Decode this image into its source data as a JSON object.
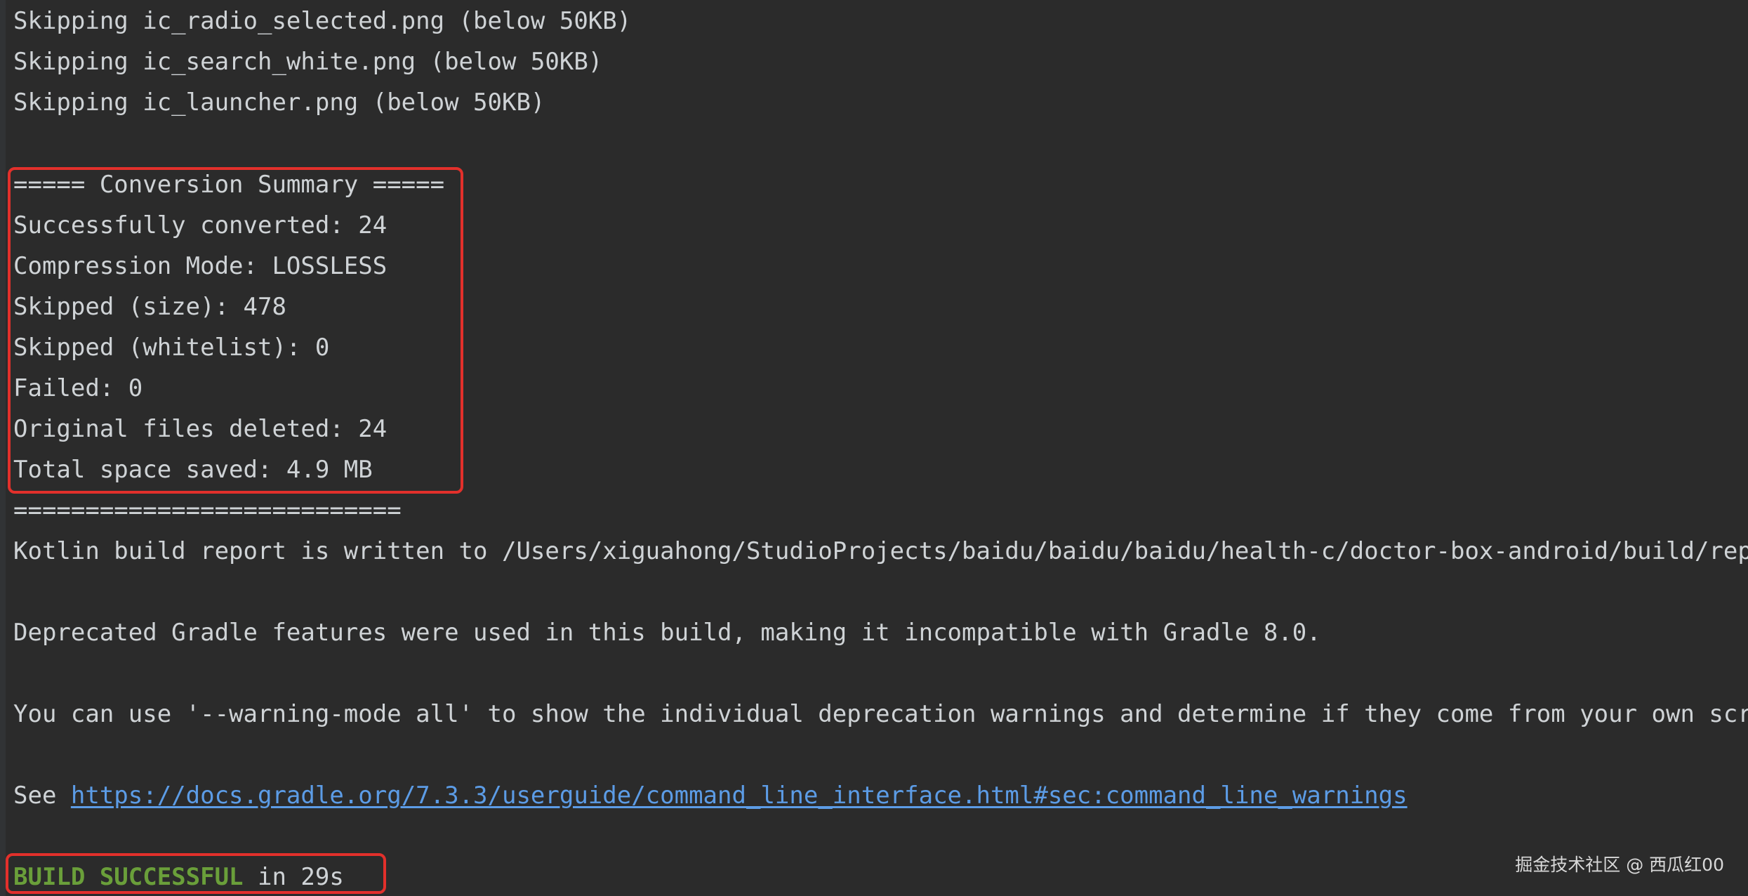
{
  "console": {
    "lines": [
      "Skipping ic_radio_selected.png (below 50KB)",
      "Skipping ic_search_white.png (below 50KB)",
      "Skipping ic_launcher.png (below 50KB)",
      "===== Conversion Summary =====",
      "Successfully converted: 24",
      "Compression Mode: LOSSLESS",
      "Skipped (size): 478",
      "Skipped (whitelist): 0",
      "Failed: 0",
      "Original files deleted: 24",
      "Total space saved: 4.9 MB",
      "===========================",
      "Kotlin build report is written to /Users/xiguahong/StudioProjects/baidu/baidu/baidu/health-c/doctor-box-android/build/reports",
      "Deprecated Gradle features were used in this build, making it incompatible with Gradle 8.0.",
      "You can use '--warning-mode all' to show the individual deprecation warnings and determine if they come from your own scripts",
      "See ",
      "https://docs.gradle.org/7.3.3/userguide/command_line_interface.html#sec:command_line_warnings",
      "BUILD SUCCESSFUL",
      " in 29s"
    ]
  },
  "watermark": "掘金技术社区 @ 西瓜红00",
  "colors": {
    "background": "#2b2b2b",
    "text": "#cfd3d6",
    "link": "#5c9ce6",
    "success": "#6a9f3a",
    "highlight_border": "#e2302b"
  }
}
